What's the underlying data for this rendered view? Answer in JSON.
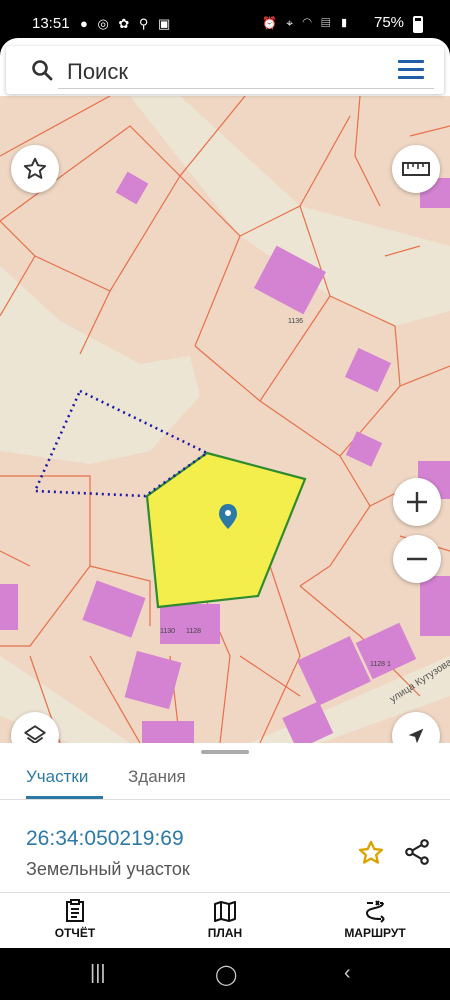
{
  "status_bar": {
    "time": "13:51",
    "battery": "75%",
    "left_icons": [
      "chat-icon",
      "whatsapp-icon",
      "pinwheel-icon",
      "search-icon",
      "image-icon"
    ],
    "right_icons": [
      "alarm-icon",
      "location-icon",
      "wifi-icon",
      "volte-icon",
      "signal-icon",
      "battery-icon"
    ]
  },
  "search": {
    "placeholder": "Поиск"
  },
  "map": {
    "street_label": "улица Кутузова",
    "building_labels": [
      "1136",
      "1130",
      "1128",
      "1138",
      "1128 1"
    ],
    "colors": {
      "parcel_fill": "#f3ee4c",
      "parcel_border": "#2e8b2e",
      "building": "#d483d2",
      "boundary": "#e8704a",
      "background": "#efd7c4",
      "road": "#ede5d4",
      "marker": "#2c79a6",
      "dotted_outline": "#1a1aa6"
    },
    "controls": [
      "favorites-star-icon",
      "ruler-icon",
      "zoom-in-icon",
      "zoom-out-icon",
      "layers-icon",
      "navigation-arrow-icon"
    ]
  },
  "sheet": {
    "tabs": [
      {
        "label": "Участки",
        "active": true
      },
      {
        "label": "Здания",
        "active": false
      }
    ],
    "parcel_id": "26:34:050219:69",
    "parcel_type": "Земельный участок"
  },
  "bottom_nav": [
    {
      "label": "ОТЧЁТ",
      "icon": "report-icon"
    },
    {
      "label": "ПЛАН",
      "icon": "map-plan-icon"
    },
    {
      "label": "МАРШРУТ",
      "icon": "route-icon"
    }
  ],
  "system_nav": [
    "recent-apps-icon",
    "home-icon",
    "back-icon"
  ]
}
